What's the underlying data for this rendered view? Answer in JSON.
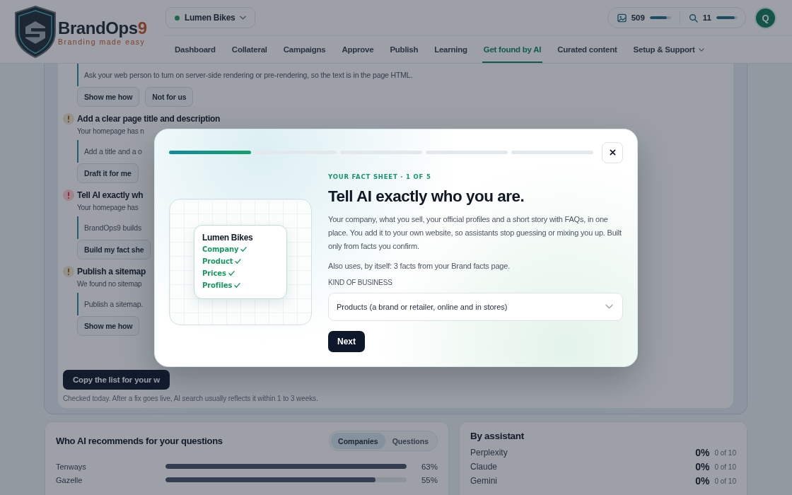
{
  "header": {
    "wordmark": [
      "BrandOps",
      "9"
    ],
    "tagline": "Branding made easy",
    "workspace": "Lumen Bikes",
    "usage": [
      {
        "kind": "images",
        "count": "509",
        "level": 0.82
      },
      {
        "kind": "searches",
        "count": "11",
        "level": 0.85
      }
    ],
    "avatar": "Q",
    "nav": [
      {
        "label": "Dashboard",
        "selected": false,
        "dropdown": false
      },
      {
        "label": "Collateral",
        "selected": false,
        "dropdown": false
      },
      {
        "label": "Campaigns",
        "selected": false,
        "dropdown": false
      },
      {
        "label": "Approve",
        "selected": false,
        "dropdown": false
      },
      {
        "label": "Publish",
        "selected": false,
        "dropdown": false
      },
      {
        "label": "Learning",
        "selected": false,
        "dropdown": false
      },
      {
        "label": "Get found by AI",
        "selected": true,
        "dropdown": false
      },
      {
        "label": "Curated content",
        "selected": false,
        "dropdown": false
      },
      {
        "label": "Setup & Support",
        "selected": false,
        "dropdown": true
      }
    ]
  },
  "checklist": {
    "items": [
      {
        "quote": "Ask your web person to turn on server-side rendering or pre-rendering, so the text is in the page HTML.",
        "actions": [
          "Show me how",
          "Not for us"
        ]
      },
      {
        "critical": false,
        "title": "Add a clear page title and description",
        "summary": "Your homepage has n",
        "quote": "Add a title and a o",
        "actions": [
          "Draft it for me"
        ]
      },
      {
        "critical": true,
        "title": "Tell AI exactly wh",
        "summary": "Your homepage has",
        "quote": "BrandOps9 builds",
        "actions": [
          "Build my fact she"
        ]
      },
      {
        "critical": false,
        "title": "Publish a sitemap",
        "summary": "We found no sitemap",
        "quote": "Publish a sitemap.",
        "actions": [
          "Show me how"
        ]
      }
    ],
    "primary_action": "Copy the list for your w",
    "note": "Checked today. After a fix goes live, AI search usually reflects it within 1 to 3 weeks."
  },
  "recommendations": {
    "title": "Who AI recommends for your questions",
    "views": [
      {
        "label": "Companies",
        "selected": true
      },
      {
        "label": "Questions",
        "selected": false
      }
    ],
    "rows": [
      {
        "name": "Tenways",
        "level": 1.0,
        "share": "63%"
      },
      {
        "name": "Gazelle",
        "level": 0.87,
        "share": "55%"
      }
    ]
  },
  "assistants": {
    "title": "By assistant",
    "rows": [
      {
        "name": "Perplexity",
        "share": "0%",
        "count": "0 of 10"
      },
      {
        "name": "Claude",
        "share": "0%",
        "count": "0 of 10"
      },
      {
        "name": "Gemini",
        "share": "0%",
        "count": "0 of 10"
      }
    ]
  },
  "dialog": {
    "steps": [
      {
        "done": true
      },
      {
        "done": false
      },
      {
        "done": false
      },
      {
        "done": false
      },
      {
        "done": false
      }
    ],
    "illustration": {
      "title": "Lumen Bikes",
      "facts": [
        {
          "label": "Company",
          "checked": true
        },
        {
          "label": "Product",
          "checked": true
        },
        {
          "label": "Prices",
          "checked": true
        },
        {
          "label": "Profiles",
          "checked": true
        }
      ]
    },
    "eyebrow": "YOUR FACT SHEET · 1 OF 5",
    "title": "Tell AI exactly who you are.",
    "description": "Your company, what you sell, your official profiles and a short story with FAQs, in one place. You add it to your own website, so assistants stop guessing or mixing you up. Built only from facts you confirm.",
    "note": "Also uses, by itself: 3 facts from your Brand facts page.",
    "field": {
      "label": "KIND OF BUSINESS",
      "value": "Products (a brand or retailer, online and in stores)"
    },
    "action": "Next"
  }
}
